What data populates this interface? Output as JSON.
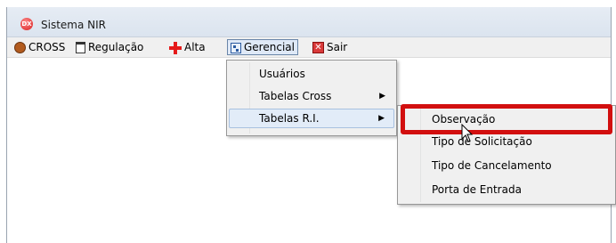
{
  "window": {
    "title": "Sistema NIR",
    "app_icon": "dx-logo-icon"
  },
  "menubar": {
    "items": [
      {
        "label": "CROSS",
        "icon": "cross-icon"
      },
      {
        "label": "Regulação",
        "icon": "clipboard-icon"
      },
      {
        "label": "Alta",
        "icon": "red-plus-icon"
      },
      {
        "label": "Gerencial",
        "icon": "settings-window-icon",
        "active": true
      },
      {
        "label": "Sair",
        "icon": "exit-icon"
      }
    ]
  },
  "gerencial_menu": {
    "items": [
      {
        "label": "Usuários",
        "has_submenu": false
      },
      {
        "label": "Tabelas Cross",
        "has_submenu": true
      },
      {
        "label": "Tabelas R.I.",
        "has_submenu": true,
        "hovered": true
      }
    ]
  },
  "tabelas_ri_menu": {
    "items": [
      {
        "label": "Observação",
        "highlighted": true
      },
      {
        "label": "Tipo de Solicitação"
      },
      {
        "label": "Tipo de Cancelamento"
      },
      {
        "label": "Porta de Entrada"
      }
    ]
  },
  "colors": {
    "highlight_border": "#d20f0f",
    "hover_bg": "#e2ecf8",
    "menu_bg": "#f0f0f0"
  }
}
